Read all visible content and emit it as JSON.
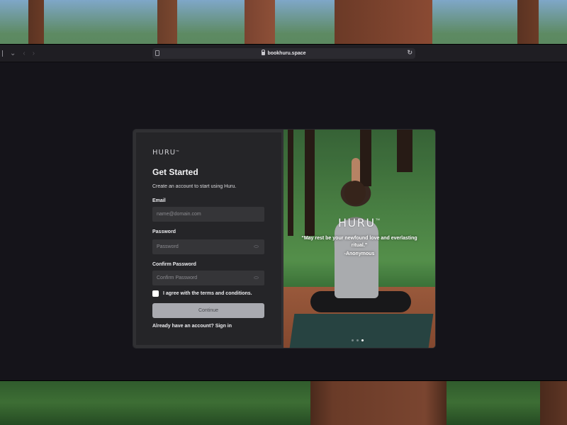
{
  "browser": {
    "url": "bookhuru.space"
  },
  "brand": {
    "logo": "HURU",
    "tm": "TM"
  },
  "form": {
    "title": "Get Started",
    "subtitle": "Create an account to start using Huru.",
    "email_label": "Email",
    "email_placeholder": "name@domain.com",
    "password_label": "Password",
    "password_placeholder": "Password",
    "confirm_label": "Confirm Password",
    "confirm_placeholder": "Confirm Password",
    "terms_label": "I agree with the terms and conditions.",
    "terms_checked": false,
    "continue_label": "Continue",
    "signin_text": "Already have an account? Sign in"
  },
  "hero": {
    "quote": "“May rest be your newfound love and everlasting ritual.”",
    "author": "-Anonymous",
    "slides_total": 3,
    "active_slide": 3
  },
  "icons": {
    "sidebar": "sidebar-toggle-icon",
    "chevron": "chevron-down-icon",
    "back": "back-icon",
    "forward": "forward-icon",
    "page": "page-icon",
    "lock": "lock-icon",
    "reload": "reload-icon",
    "eye": "eye-icon"
  },
  "colors": {
    "page_bg": "#15141a",
    "card_form_bg": "#252528",
    "input_bg": "#353538",
    "button_bg": "#a9aab0"
  }
}
